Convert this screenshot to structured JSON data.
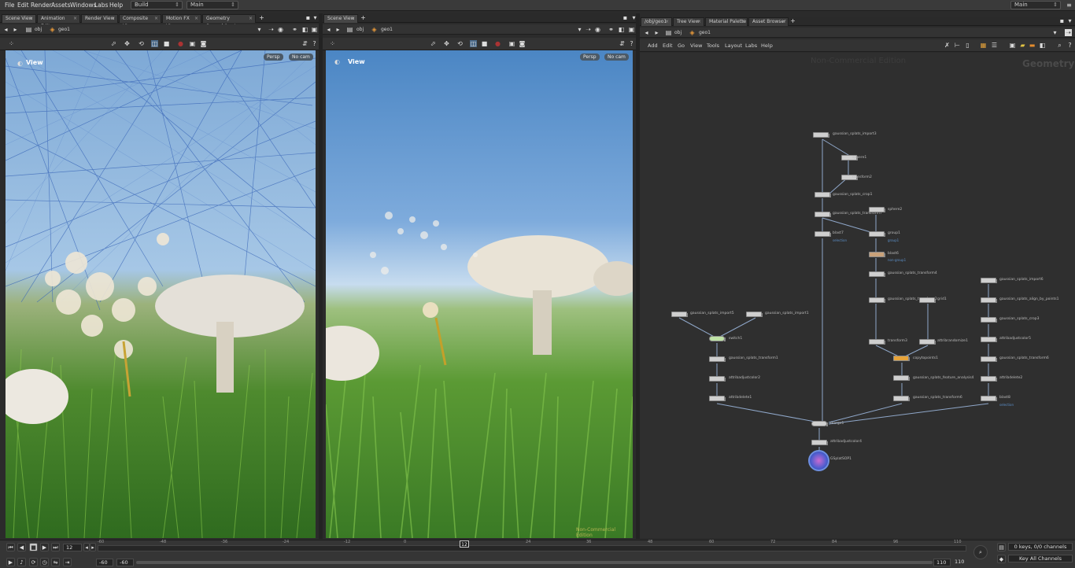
{
  "menu": {
    "file": "File",
    "edit": "Edit",
    "render": "Render",
    "assets": "Assets",
    "windows": "Windows",
    "labs": "Labs",
    "help": "Help",
    "build": "Build",
    "desktop": "Main",
    "workspace": "Main"
  },
  "left_tabs": [
    "Scene View",
    "Animation Editor",
    "Render View",
    "Composite View",
    "Motion FX View",
    "Geometry Spreadsheet"
  ],
  "mid_tabs": [
    "Scene View"
  ],
  "right_tabs": [
    "/obj/geo1",
    "Tree View",
    "Material Palette",
    "Asset Browser"
  ],
  "path": {
    "obj": "obj",
    "geo": "geo1"
  },
  "view_left": {
    "label": "View",
    "persp": "Persp",
    "cam": "No cam"
  },
  "view_mid": {
    "label": "View",
    "persp": "Persp",
    "cam": "No cam",
    "watermark": "Non-Commercial Edition"
  },
  "net_menu": {
    "add": "Add",
    "edit": "Edit",
    "go": "Go",
    "view": "View",
    "tools": "Tools",
    "layout": "Layout",
    "labs": "Labs",
    "help": "Help"
  },
  "net": {
    "watermark": "Non-Commercial Edition",
    "context": "Geometry"
  },
  "nodes": {
    "n1": "gaussian_splats_import3",
    "n2": "sphere1",
    "n3": "transform2",
    "n4": "gaussian_splats_crop1",
    "n5": "gaussian_splats_transform7",
    "n6": "sphere2",
    "n7": "blast7",
    "n8": "group1",
    "n9": "blast6",
    "n10": "gaussian_splats_transform4",
    "n11": "gaussian_splats_transform2",
    "n12": "grid1",
    "n13": "transform3",
    "n14": "attribrandomize1",
    "n15": "copytopoints1",
    "n16": "gaussian_splats_feature_analysis4",
    "n17": "gaussian_splats_transform6",
    "n18": "gaussian_splats_import5",
    "n19": "gaussian_splats_import1",
    "n20": "switch1",
    "n21": "gaussian_splats_transform1",
    "n22": "attribadjustcolor2",
    "n23": "attribdelete1",
    "n24": "merge1",
    "n25": "attribadjustcolor4",
    "n26": "GSplatSOP1",
    "n27": "gaussian_splats_import6",
    "n28": "gaussian_splats_align_by_points1",
    "n29": "gaussian_splats_crop3",
    "n30": "attribadjustcolor5",
    "n31": "gaussian_splats_transform6",
    "n32": "attribdelete2",
    "n33": "blast8"
  },
  "node_subs": {
    "s1": "selection",
    "s2": "group1",
    "s3": "non-group1",
    "s4": "selection"
  },
  "timeline": {
    "frame": "12",
    "ticks": [
      "-60",
      "-48",
      "-36",
      "-24",
      "-12",
      "0",
      "12",
      "24",
      "36",
      "48",
      "60",
      "72",
      "84",
      "96",
      "110"
    ],
    "start": "-60",
    "start2": "-60",
    "end": "110",
    "end2": "110",
    "keys": "0 keys, 0/0 channels",
    "key_all": "Key All Channels"
  }
}
